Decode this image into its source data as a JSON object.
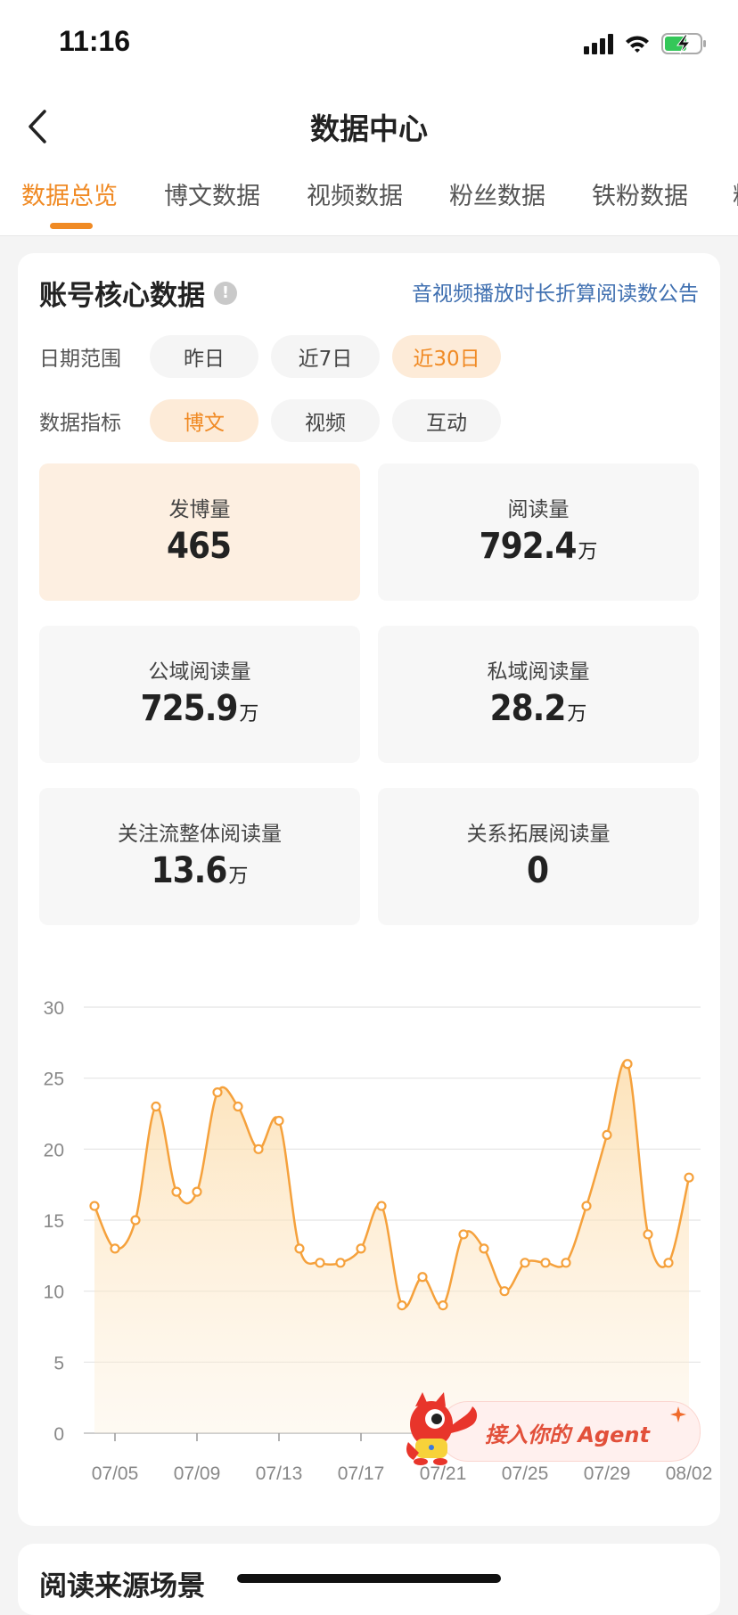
{
  "status_bar": {
    "time": "11:16"
  },
  "nav": {
    "title": "数据中心",
    "back_icon": "chevron-left-icon"
  },
  "tabs": [
    {
      "label": "数据总览",
      "active": true
    },
    {
      "label": "博文数据",
      "active": false
    },
    {
      "label": "视频数据",
      "active": false
    },
    {
      "label": "粉丝数据",
      "active": false
    },
    {
      "label": "铁粉数据",
      "active": false
    },
    {
      "label": "粉",
      "active": false
    }
  ],
  "core": {
    "title": "账号核心数据",
    "info_icon": "info-icon",
    "notice_link": "音视频播放时长折算阅读数公告",
    "date_range": {
      "label": "日期范围",
      "options": [
        "昨日",
        "近7日",
        "近30日"
      ],
      "selected": "近30日"
    },
    "metric": {
      "label": "数据指标",
      "options": [
        "博文",
        "视频",
        "互动"
      ],
      "selected": "博文"
    },
    "stats": [
      {
        "label": "发博量",
        "value": "465",
        "unit": ""
      },
      {
        "label": "阅读量",
        "value": "792.4",
        "unit": "万"
      },
      {
        "label": "公域阅读量",
        "value": "725.9",
        "unit": "万"
      },
      {
        "label": "私域阅读量",
        "value": "28.2",
        "unit": "万"
      },
      {
        "label": "关注流整体阅读量",
        "value": "13.6",
        "unit": "万"
      },
      {
        "label": "关系拓展阅读量",
        "value": "0",
        "unit": ""
      }
    ]
  },
  "chart_data": {
    "type": "area",
    "x": [
      "07/04",
      "07/05",
      "07/06",
      "07/07",
      "07/08",
      "07/09",
      "07/10",
      "07/11",
      "07/12",
      "07/13",
      "07/14",
      "07/15",
      "07/16",
      "07/17",
      "07/18",
      "07/19",
      "07/20",
      "07/21",
      "07/22",
      "07/23",
      "07/24",
      "07/25",
      "07/26",
      "07/27",
      "07/28",
      "07/29",
      "07/30",
      "07/31",
      "08/01",
      "08/02",
      "08/03"
    ],
    "values": [
      16,
      13,
      15,
      23,
      17,
      17,
      24,
      23,
      20,
      22,
      13,
      12,
      12,
      13,
      16,
      9,
      11,
      9,
      14,
      13,
      10,
      12,
      12,
      12,
      16,
      21,
      26,
      14,
      12,
      18,
      null
    ],
    "x_tick_labels": [
      "07/05",
      "07/09",
      "07/13",
      "07/17",
      "07/21",
      "07/25",
      "07/29",
      "08/02"
    ],
    "y_ticks": [
      0,
      5,
      10,
      15,
      20,
      25,
      30
    ],
    "ylim": [
      0,
      30
    ],
    "grid": true,
    "colors": {
      "line": "#f5a13c",
      "fill": "#fde7c3"
    }
  },
  "agent_badge": {
    "text": "接入你的 Agent"
  },
  "section2": {
    "title": "阅读来源场景"
  }
}
